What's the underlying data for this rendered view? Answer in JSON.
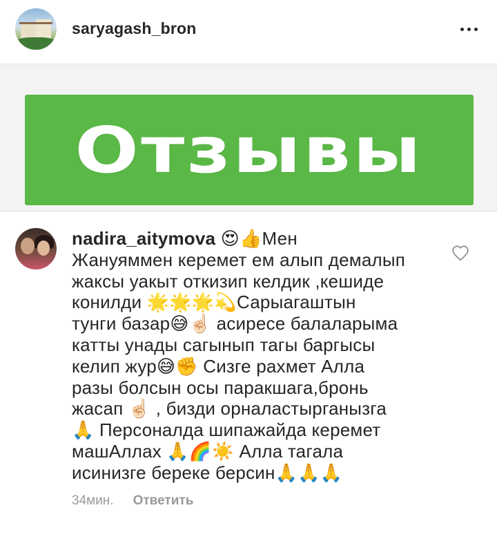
{
  "post": {
    "username": "saryagash_bron",
    "banner_text": "Отзывы",
    "banner_color": "#5ab847"
  },
  "comment": {
    "username": "nadira_aitymova",
    "lines": [
      " 😍👍Мен",
      "Жануяммен керемет ем алып демалып",
      "жаксы уакыт откизип келдик ,кешиде",
      "конилди 🌟🌟🌟💫Сарыагаштын",
      "тунги базар😅☝🏻 асиресе балаларыма",
      "катты унады сагынып тагы баргысы",
      "келип жур😅✊ Сизге рахмет Алла",
      "разы болсын осы паракшага,бронь",
      "жасап ☝🏻 , бизди орналастырганызга",
      "🙏 Персоналда шипажайда керемет",
      "машАллах 🙏🌈☀️ Алла тагала",
      "исинизге береке берсин🙏🙏🙏"
    ],
    "time": "34мин.",
    "reply_label": "Ответить"
  },
  "icons": {
    "more": "more-options-icon",
    "like": "heart-icon"
  }
}
